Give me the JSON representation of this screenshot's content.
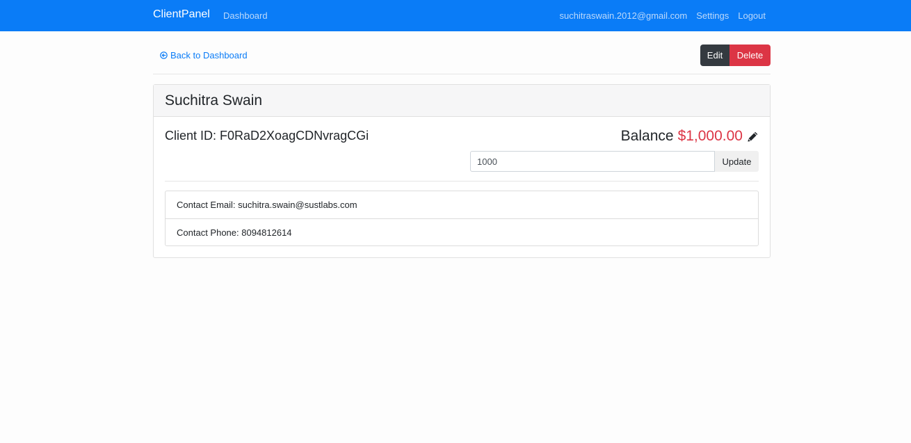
{
  "navbar": {
    "brand": "ClientPanel",
    "dashboard": "Dashboard",
    "user_email": "suchitraswain.2012@gmail.com",
    "settings": "Settings",
    "logout": "Logout"
  },
  "toolbar": {
    "back_label": "Back to Dashboard",
    "edit_label": "Edit",
    "delete_label": "Delete"
  },
  "client": {
    "name": "Suchitra Swain",
    "id_label": "Client ID: F0RaD2XoagCDNvragCGi",
    "balance_label": "Balance",
    "balance_amount": "$1,000.00",
    "balance_input_value": "1000",
    "update_label": "Update",
    "contact_email": "Contact Email: suchitra.swain@sustlabs.com",
    "contact_phone": "Contact Phone: 8094812614"
  },
  "icons": {
    "back": "arrow-circle-left-icon",
    "edit_balance": "pencil-icon"
  },
  "colors": {
    "navbar": "#0a7cf7",
    "danger": "#dc3545",
    "dark": "#343a40",
    "link": "#0a7cf7"
  }
}
